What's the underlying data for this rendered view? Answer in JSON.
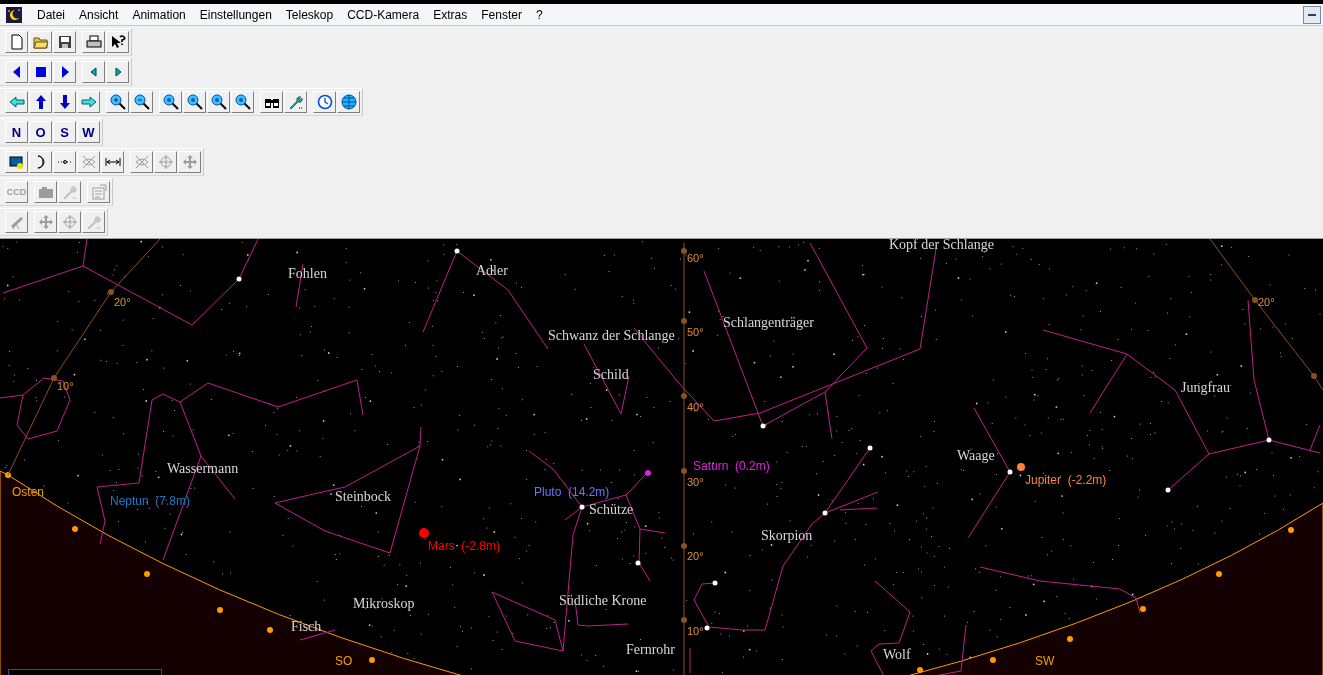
{
  "menu": {
    "items": [
      "Datei",
      "Ansicht",
      "Animation",
      "Einstellungen",
      "Teleskop",
      "CCD-Kamera",
      "Extras",
      "Fenster",
      "?"
    ]
  },
  "toolbars": [
    {
      "groups": [
        [
          {
            "kind": "new",
            "disabled": false
          },
          {
            "kind": "open",
            "disabled": false
          },
          {
            "kind": "save",
            "disabled": false
          }
        ],
        [
          {
            "kind": "print",
            "disabled": false
          },
          {
            "kind": "help",
            "disabled": false
          }
        ]
      ]
    },
    {
      "groups": [
        [
          {
            "kind": "back",
            "disabled": false
          },
          {
            "kind": "stop",
            "disabled": false
          },
          {
            "kind": "play",
            "disabled": false
          }
        ],
        [
          {
            "kind": "stepback",
            "disabled": false
          },
          {
            "kind": "stepfwd",
            "disabled": false
          }
        ]
      ]
    },
    {
      "groups": [
        [
          {
            "kind": "left",
            "disabled": false
          },
          {
            "kind": "up",
            "disabled": false
          },
          {
            "kind": "down",
            "disabled": false
          },
          {
            "kind": "right",
            "disabled": false
          }
        ],
        [
          {
            "kind": "zoomin",
            "disabled": false
          },
          {
            "kind": "zoomout",
            "disabled": false
          }
        ],
        [
          {
            "kind": "zoom",
            "disabled": false
          },
          {
            "kind": "zoom",
            "disabled": false
          },
          {
            "kind": "zoom",
            "disabled": false
          },
          {
            "kind": "zoom",
            "disabled": false
          }
        ],
        [
          {
            "kind": "binoculars",
            "disabled": false
          },
          {
            "kind": "wrench",
            "disabled": false
          }
        ],
        [
          {
            "kind": "clock",
            "disabled": false
          },
          {
            "kind": "globe",
            "disabled": false
          }
        ]
      ]
    },
    {
      "groups": [
        [
          {
            "kind": "text",
            "label": "N",
            "disabled": false
          },
          {
            "kind": "text",
            "label": "O",
            "disabled": false
          },
          {
            "kind": "text",
            "label": "S",
            "disabled": false
          },
          {
            "kind": "text",
            "label": "W",
            "disabled": false
          }
        ]
      ]
    },
    {
      "groups": [
        [
          {
            "kind": "view",
            "disabled": false
          },
          {
            "kind": "moon",
            "disabled": false
          },
          {
            "kind": "dots",
            "disabled": false
          },
          {
            "kind": "crossed",
            "disabled": true
          },
          {
            "kind": "distance",
            "disabled": false
          }
        ],
        [
          {
            "kind": "crossed",
            "disabled": true
          },
          {
            "kind": "target",
            "disabled": true
          },
          {
            "kind": "move",
            "disabled": true
          }
        ]
      ]
    },
    {
      "groups": [
        [
          {
            "kind": "text",
            "label": "CCD",
            "disabled": true
          }
        ],
        [
          {
            "kind": "camera",
            "disabled": true
          },
          {
            "kind": "wrench",
            "disabled": true
          }
        ],
        [
          {
            "kind": "props",
            "disabled": true
          }
        ]
      ]
    },
    {
      "groups": [
        [
          {
            "kind": "telescope",
            "disabled": true
          }
        ],
        [
          {
            "kind": "move",
            "disabled": true
          },
          {
            "kind": "target",
            "disabled": true
          },
          {
            "kind": "wrench",
            "disabled": true
          }
        ]
      ]
    }
  ],
  "sky_map": {
    "constellations": [
      "Kopf der Schlange",
      "Fohlen",
      "Adler",
      "Schlangenträger",
      "Schwanz der Schlange",
      "Schild",
      "Jungfrau",
      "Waage",
      "Wassermann",
      "Steinbock",
      "Schütze",
      "Skorpion",
      "Südliche Krone",
      "Mikroskop",
      "Fisch",
      "Fernrohr",
      "Wolf"
    ],
    "planets": [
      {
        "label": "Neptun  (7.8m)",
        "color": "#1e78c8"
      },
      {
        "label": "Pluto  (14.2m)",
        "color": "#7070ff"
      },
      {
        "label": "Saturn  (0.2m)",
        "color": "#e020e0"
      },
      {
        "label": "Mars  (-2.8m)",
        "color": "#ff0000"
      },
      {
        "label": "Jupiter  (-2.2m)",
        "color": "#ff8040"
      }
    ],
    "altitude_labels": [
      "20°",
      "10°",
      "60°",
      "50°",
      "40°",
      "30°",
      "20°",
      "10°",
      "20°"
    ],
    "directions": [
      "Osten",
      "SO",
      "SW"
    ]
  }
}
